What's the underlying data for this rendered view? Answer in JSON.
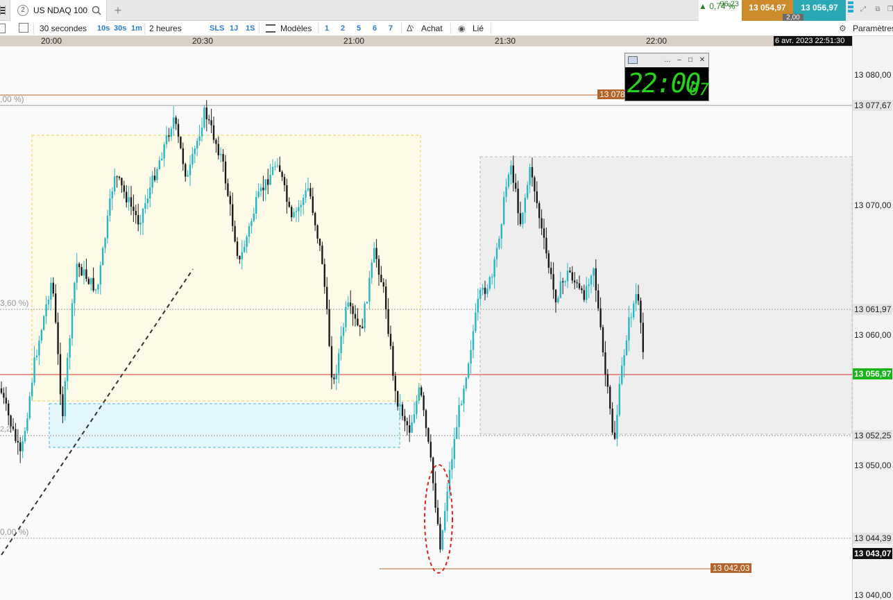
{
  "window": {
    "tab_number": "2",
    "instrument": "US NDAQ 100",
    "change_pct": "0,74 %",
    "change_abs": "96,23",
    "bid": "13 054,97",
    "ask": "13 056,97",
    "spread": "2,00"
  },
  "toolbar": {
    "interval": "30 secondes",
    "interval_buttons": [
      "10s",
      "30s",
      "1m"
    ],
    "period": "2 heures",
    "period_buttons": [
      "SLS",
      "1J",
      "1S"
    ],
    "templates_label": "Modèles",
    "template_slots": [
      "1",
      "2",
      "5",
      "6",
      "7"
    ],
    "buy_label": "Achat",
    "linked_label": "Lié",
    "settings_label": "Paramètres"
  },
  "time_axis": {
    "ticks": [
      "20:00",
      "20:30",
      "21:00",
      "21:30",
      "22:00"
    ],
    "cursor_datetime": "6 avr. 2023 22:51:30"
  },
  "price_axis": {
    "labels": [
      "13 080,00",
      "13 077,67",
      "13 070,00",
      "13 061,97",
      "13 060,00",
      "13 056,97",
      "13 052,25",
      "13 050,00",
      "13 044,39",
      "13 043,07",
      "13 040,00"
    ],
    "current_price": "13 056,97"
  },
  "chart": {
    "fib_labels": [
      ",00 %)",
      "3,60 %)",
      "0,00 %)"
    ],
    "fib_mid_label": "2,2",
    "high_tag": "13 078",
    "low_tag": "13 042,03",
    "colors": {
      "bull": "#27b6c4",
      "bear": "#1a1a1a",
      "current_line": "#e03030",
      "level_line": "#b5652a",
      "yellow_zone": "#fdfbe8",
      "cyan_zone": "#e3f6fb",
      "grey_zone": "#eeeeee"
    }
  },
  "clock_widget": {
    "time": "22:00",
    "seconds": "07"
  }
}
